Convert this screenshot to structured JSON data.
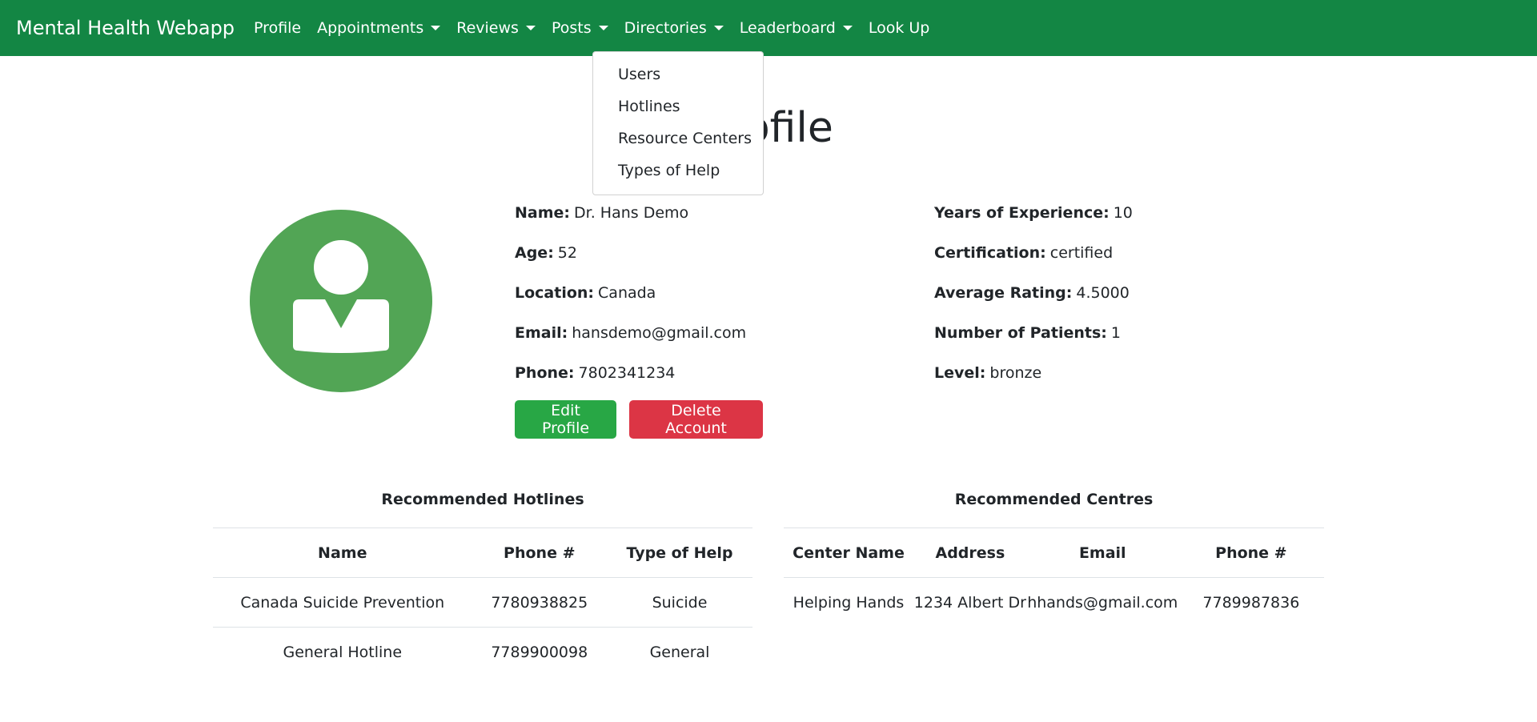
{
  "navbar": {
    "brand": "Mental Health Webapp",
    "items": [
      {
        "label": "Profile",
        "dropdown": false
      },
      {
        "label": "Appointments",
        "dropdown": true
      },
      {
        "label": "Reviews",
        "dropdown": true
      },
      {
        "label": "Posts",
        "dropdown": true
      },
      {
        "label": "Directories",
        "dropdown": true
      },
      {
        "label": "Leaderboard",
        "dropdown": true
      },
      {
        "label": "Look Up",
        "dropdown": false
      }
    ]
  },
  "directories_menu": {
    "items": [
      "Users",
      "Hotlines",
      "Resource Centers",
      "Types of Help"
    ]
  },
  "page": {
    "title": "Profile"
  },
  "profile": {
    "avatar_icon": "user-avatar-icon",
    "left": [
      {
        "label": "Name:",
        "value": "Dr. Hans Demo"
      },
      {
        "label": "Age:",
        "value": "52"
      },
      {
        "label": "Location:",
        "value": "Canada"
      },
      {
        "label": "Email:",
        "value": "hansdemo@gmail.com"
      },
      {
        "label": "Phone:",
        "value": "7802341234"
      }
    ],
    "right": [
      {
        "label": "Years of Experience:",
        "value": "10"
      },
      {
        "label": "Certification:",
        "value": "certified"
      },
      {
        "label": "Average Rating:",
        "value": "4.5000"
      },
      {
        "label": "Number of Patients:",
        "value": "1"
      },
      {
        "label": "Level:",
        "value": "bronze"
      }
    ]
  },
  "buttons": {
    "edit": "Edit Profile",
    "delete": "Delete Account"
  },
  "hotlines": {
    "caption": "Recommended Hotlines",
    "headers": [
      "Name",
      "Phone #",
      "Type of Help"
    ],
    "rows": [
      [
        "Canada Suicide Prevention",
        "7780938825",
        "Suicide"
      ],
      [
        "General Hotline",
        "7789900098",
        "General"
      ]
    ]
  },
  "centres": {
    "caption": "Recommended Centres",
    "headers": [
      "Center Name",
      "Address",
      "Email",
      "Phone #"
    ],
    "rows": [
      [
        "Helping Hands",
        "1234 Albert Dr",
        "hhands@gmail.com",
        "7789987836"
      ]
    ]
  },
  "colors": {
    "navbar": "#138644",
    "avatar": "#52a555",
    "edit_button": "#28a745",
    "delete_button": "#dc3545"
  }
}
